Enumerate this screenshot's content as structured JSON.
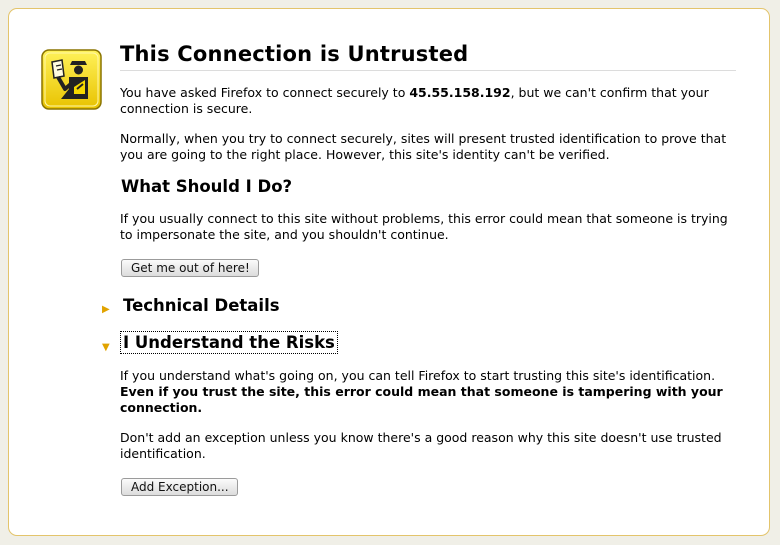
{
  "page": {
    "title": "This Connection is Untrusted",
    "intro_prefix": "You have asked Firefox to connect securely to ",
    "host": "45.55.158.192",
    "intro_suffix": ", but we can't confirm that your connection is secure.",
    "normally_text": "Normally, when you try to connect securely, sites will present trusted identification to prove that you are going to the right place. However, this site's identity can't be verified.",
    "what_heading": "What Should I Do?",
    "what_text": "If you usually connect to this site without problems, this error could mean that someone is trying to impersonate the site, and you shouldn't continue.",
    "get_out_button": "Get me out of here!",
    "technical_details": {
      "label": "Technical Details",
      "expanded": false,
      "arrow": "▶"
    },
    "risks": {
      "label": "I Understand the Risks",
      "expanded": true,
      "arrow": "▼",
      "text_normal": "If you understand what's going on, you can tell Firefox to start trusting this site's identification. ",
      "text_bold": "Even if you trust the site, this error could mean that someone is tampering with your connection.",
      "exception_text": "Don't add an exception unless you know there's a good reason why this site doesn't use trusted identification.",
      "add_exception_button": "Add Exception..."
    }
  },
  "icon": "security-guard-icon",
  "colors": {
    "panel_border": "#e3c46b",
    "icon_yellow": "#f5d800",
    "arrow": "#e1a300",
    "background": "#f0efe7"
  }
}
